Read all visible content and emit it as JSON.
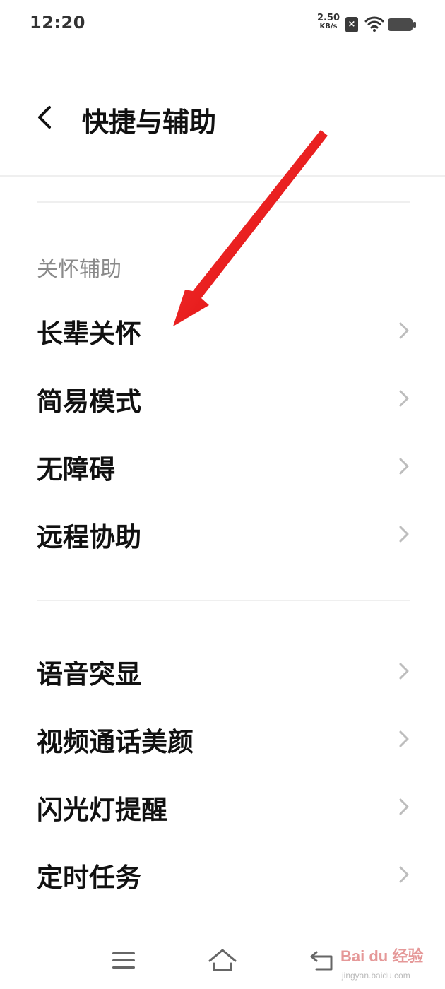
{
  "status_bar": {
    "time": "12:20",
    "net_speed_value": "2.50",
    "net_speed_unit": "KB/s",
    "sim_label": "×",
    "icons": [
      "sim-off-icon",
      "wifi-icon",
      "battery-icon"
    ]
  },
  "header": {
    "title": "快捷与辅助",
    "back_icon": "chevron-left-icon"
  },
  "section1": {
    "title": "关怀辅助",
    "items": [
      {
        "label": "长辈关怀"
      },
      {
        "label": "简易模式"
      },
      {
        "label": "无障碍"
      },
      {
        "label": "远程协助"
      }
    ]
  },
  "section2": {
    "items": [
      {
        "label": "语音突显"
      },
      {
        "label": "视频通话美颜"
      },
      {
        "label": "闪光灯提醒"
      },
      {
        "label": "定时任务"
      }
    ]
  },
  "nav_bar": {
    "icons": [
      "menu-icon",
      "home-icon",
      "back-icon"
    ]
  },
  "watermark": {
    "brand": "Bai du 经验",
    "url": "jingyan.baidu.com"
  },
  "colors": {
    "background": "#ffffff",
    "text_primary": "#111111",
    "text_secondary": "#8a8a8a",
    "divider": "#efefef",
    "chevron": "#bdbdbd",
    "annotation_arrow": "#e00000"
  }
}
